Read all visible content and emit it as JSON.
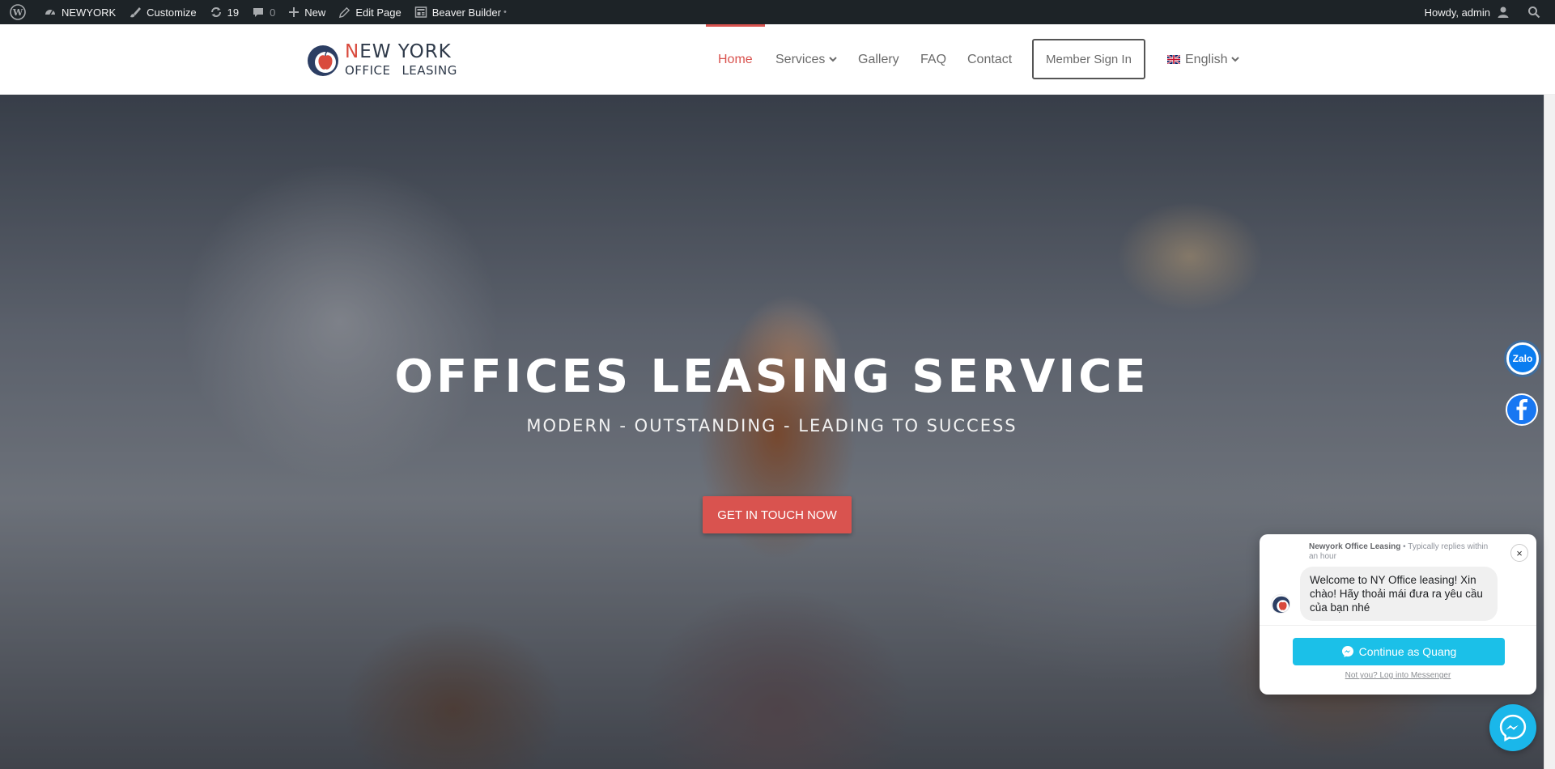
{
  "admin_bar": {
    "site_name": "NEWYORK",
    "customize": "Customize",
    "updates_count": "19",
    "comments_count": "0",
    "new_label": "New",
    "edit_page": "Edit Page",
    "beaver_builder": "Beaver Builder",
    "beaver_marker": "•",
    "howdy": "Howdy, admin"
  },
  "logo": {
    "line1_initial": "N",
    "line1_rest": "EW YORK",
    "line2_a": "OFFICE",
    "line2_b": "LEASING"
  },
  "nav": {
    "items": [
      {
        "label": "Home",
        "active": true
      },
      {
        "label": "Services"
      },
      {
        "label": "Gallery"
      },
      {
        "label": "FAQ"
      },
      {
        "label": "Contact"
      }
    ],
    "member_sign_in": "Member Sign In",
    "language": "English"
  },
  "hero": {
    "title": "OFFICES LEASING SERVICE",
    "subtitle": "MODERN - OUTSTANDING - LEADING TO SUCCESS",
    "cta": "GET IN TOUCH NOW"
  },
  "floating": {
    "zalo_label": "Zalo"
  },
  "chat": {
    "page_name": "Newyork Office Leasing",
    "reply_time": "Typically replies within an hour",
    "separator": "•",
    "message": "Welcome to NY Office leasing! Xin chào! Hãy thoải mái đưa ra yêu cầu của bạn nhé",
    "continue_button": "Continue as Quang",
    "not_you": "Not you? Log into Messenger",
    "close": "×"
  },
  "colors": {
    "accent": "#d9534f",
    "admin_bar": "#1d2327",
    "messenger": "#1bc0e8",
    "facebook": "#1877f2",
    "zalo": "#0a7df0"
  }
}
